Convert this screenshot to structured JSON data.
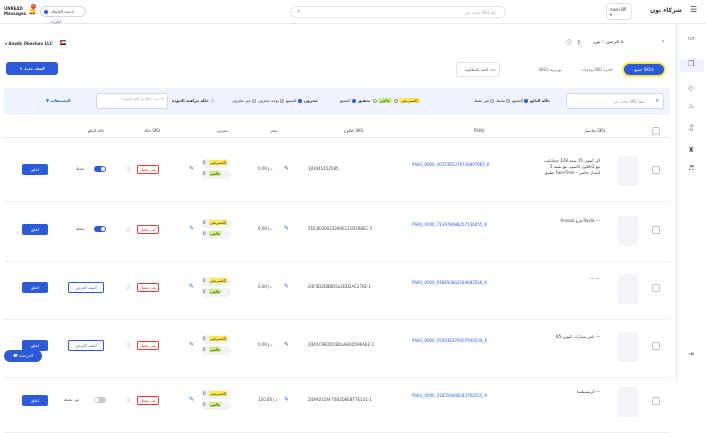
{
  "topbar": {
    "messages_label": "UNREAD\nMessages",
    "notif_count": "9",
    "location_label": "لاحجة الغلطان امارات",
    "search_placeholder": "ابحث عن SKU هنا...",
    "user_name": "noon BP",
    "brand": "شركاء نون"
  },
  "company": "Anwik Obashan LLC",
  "breadcrumb": "فريس",
  "breadcrumb_parent": "نون",
  "add_button": "+ أضف جديد",
  "tabs": [
    "جميع SKUs",
    "وحدات SKU الحرة",
    "SKUs بورتريه",
    "حدد الفئة المطلوبة"
  ],
  "filters": {
    "search_placeholder": "ابحث عن SKU هنا...",
    "seller_state": "حالة البائع",
    "all": "الجميع",
    "active": "نشط",
    "inactive": "غير نشط",
    "verification": "تحقيق",
    "all2": "الجميع",
    "express": "إكسبريس",
    "global": "عالمي",
    "stock": "مخزون",
    "all3": "الجميع",
    "in_stock": "يوجد مخزون",
    "no_stock": "غير مخزون",
    "quality_state": "حالة مراقبة الجودة",
    "quality_select": "حدد حالة مراقبة الجودة",
    "settings": "التصنيفات"
  },
  "table": {
    "headers": [
      "تفاصيل SKU",
      "PSKU",
      "كتالوج SKU",
      "سعر",
      "مخزون",
      "حالة SKU",
      "حالة البائع"
    ],
    "rows": [
      {
        "name": "أبل\nآيفون 15 سعة 128 جيجابايت باللون الأسود، مع تقنية 5G مع تطبيق FaceTime - إصدار عالمي",
        "psku": "PSKU_0000_4037365378738807965_K",
        "code": "183445152585",
        "price": "0.00 د.إ",
        "stock1": "0",
        "stock2": "0",
        "sku_status": "غير مفعل",
        "seller_status": "نشط",
        "has_offer": false,
        "action": "اعلق"
      },
      {
        "name": "Aroosa فرع Rayla\n---",
        "psku": "PSKU_0000_713978088257136055_K",
        "code": "ZDC8030023280E121D598EC-1",
        "price": "0.00 د.إ",
        "stock1": "0",
        "stock2": "0",
        "sku_status": "غير مفعل",
        "seller_status": "نشط",
        "has_offer": false,
        "action": "اعلق"
      },
      {
        "name": "---\n---",
        "psku": "PSKU_0000_918650842184683546_K",
        "code": "Z4F0D2D8BD5e2DD2AC276E-1",
        "price": "0.00 د.إ",
        "stock1": "0",
        "stock2": "0",
        "sku_status": "غير مفعل",
        "seller_status": "",
        "has_offer": true,
        "action": "اعلق"
      },
      {
        "name": "85 باس سيارات كيوتي\n---",
        "psku": "PSKU_0000_250936276007940534_X",
        "code": "Z4A5C9EDDCBDaAE0D596A6Z-1",
        "price": "0.00 د.إ",
        "stock1": "0",
        "stock2": "0",
        "sku_status": "غير مفعل",
        "seller_status": "",
        "has_offer": true,
        "action": "اعلق"
      },
      {
        "name": "كريستيلسا\n---",
        "psku": "PSKU_0000_318556848243764555_X",
        "code": "Z4A9215AF70B2D6EBT7E131-1",
        "price": "120.00 د.إ",
        "stock1": "0",
        "stock2": "0",
        "sku_status": "غير مفعل",
        "seller_status": "غير نشط",
        "has_offer": false,
        "action": "اعلق"
      }
    ]
  },
  "offer_label": "أضف العرض",
  "express_tag": "إكسبريس",
  "global_tag": "عالمي",
  "chat": "الدردشة"
}
